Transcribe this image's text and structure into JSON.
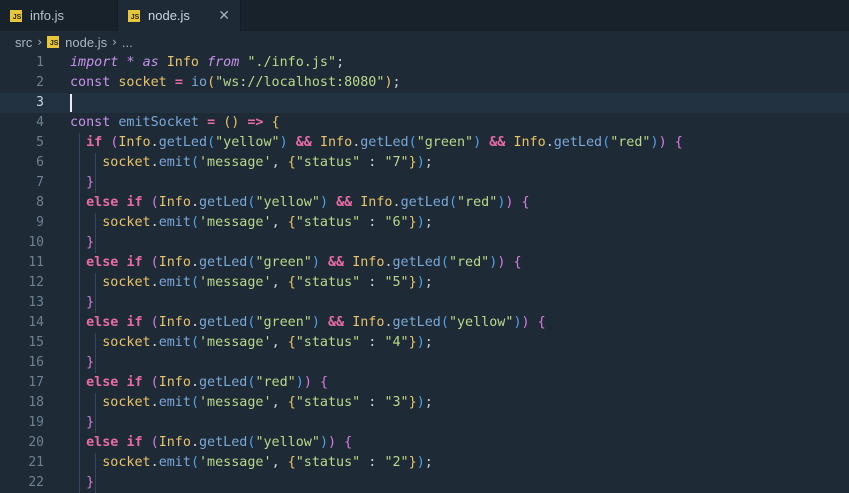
{
  "tabs": [
    {
      "badge": "JS",
      "label": "info.js",
      "active": false
    },
    {
      "badge": "JS",
      "label": "node.js",
      "active": true,
      "close": "✕"
    }
  ],
  "breadcrumb": {
    "folder": "src",
    "sep": "›",
    "badge": "JS",
    "file": "node.js",
    "more": "..."
  },
  "editor": {
    "current_line": 3,
    "lines": [
      {
        "n": "1",
        "tokens": [
          [
            "kw-italic",
            "import"
          ],
          [
            "punc",
            " "
          ],
          [
            "kw-italic",
            "*"
          ],
          [
            "punc",
            " "
          ],
          [
            "kw-italic",
            "as"
          ],
          [
            "punc",
            " "
          ],
          [
            "cls",
            "Info"
          ],
          [
            "punc",
            " "
          ],
          [
            "kw-italic",
            "from"
          ],
          [
            "punc",
            " "
          ],
          [
            "str",
            "\"./info.js\""
          ],
          [
            "punc",
            ";"
          ]
        ]
      },
      {
        "n": "2",
        "tokens": [
          [
            "kw",
            "const"
          ],
          [
            "punc",
            " "
          ],
          [
            "cls",
            "socket"
          ],
          [
            "punc",
            " "
          ],
          [
            "op",
            "="
          ],
          [
            "punc",
            " "
          ],
          [
            "fn",
            "io"
          ],
          [
            "p1",
            "("
          ],
          [
            "str",
            "\"ws://localhost:8080\""
          ],
          [
            "p1",
            ")"
          ],
          [
            "punc",
            ";"
          ]
        ]
      },
      {
        "n": "3",
        "tokens": []
      },
      {
        "n": "4",
        "tokens": [
          [
            "kw",
            "const"
          ],
          [
            "punc",
            " "
          ],
          [
            "fn",
            "emitSocket"
          ],
          [
            "punc",
            " "
          ],
          [
            "op",
            "="
          ],
          [
            "punc",
            " "
          ],
          [
            "p1",
            "()"
          ],
          [
            "punc",
            " "
          ],
          [
            "op",
            "=>"
          ],
          [
            "punc",
            " "
          ],
          [
            "p1",
            "{"
          ]
        ]
      },
      {
        "n": "5",
        "tokens": [
          [
            "punc",
            "  "
          ],
          [
            "kw-bold",
            "if"
          ],
          [
            "punc",
            " "
          ],
          [
            "p2",
            "("
          ],
          [
            "cls",
            "Info"
          ],
          [
            "punc",
            "."
          ],
          [
            "fn",
            "getLed"
          ],
          [
            "p3",
            "("
          ],
          [
            "str",
            "\"yellow\""
          ],
          [
            "p3",
            ")"
          ],
          [
            "punc",
            " "
          ],
          [
            "op",
            "&&"
          ],
          [
            "punc",
            " "
          ],
          [
            "cls",
            "Info"
          ],
          [
            "punc",
            "."
          ],
          [
            "fn",
            "getLed"
          ],
          [
            "p3",
            "("
          ],
          [
            "str",
            "\"green\""
          ],
          [
            "p3",
            ")"
          ],
          [
            "punc",
            " "
          ],
          [
            "op",
            "&&"
          ],
          [
            "punc",
            " "
          ],
          [
            "cls",
            "Info"
          ],
          [
            "punc",
            "."
          ],
          [
            "fn",
            "getLed"
          ],
          [
            "p3",
            "("
          ],
          [
            "str",
            "\"red\""
          ],
          [
            "p3",
            ")"
          ],
          [
            "p2",
            ")"
          ],
          [
            "punc",
            " "
          ],
          [
            "p2",
            "{"
          ]
        ]
      },
      {
        "n": "6",
        "tokens": [
          [
            "punc",
            "    "
          ],
          [
            "cls",
            "socket"
          ],
          [
            "punc",
            "."
          ],
          [
            "fn",
            "emit"
          ],
          [
            "p3",
            "("
          ],
          [
            "str",
            "'message'"
          ],
          [
            "punc",
            ", "
          ],
          [
            "p1",
            "{"
          ],
          [
            "str",
            "\"status\""
          ],
          [
            "punc",
            " : "
          ],
          [
            "str",
            "\"7\""
          ],
          [
            "p1",
            "}"
          ],
          [
            "p3",
            ")"
          ],
          [
            "punc",
            ";"
          ]
        ]
      },
      {
        "n": "7",
        "tokens": [
          [
            "punc",
            "  "
          ],
          [
            "p2",
            "}"
          ]
        ]
      },
      {
        "n": "8",
        "tokens": [
          [
            "punc",
            "  "
          ],
          [
            "kw-bold",
            "else"
          ],
          [
            "punc",
            " "
          ],
          [
            "kw-bold",
            "if"
          ],
          [
            "punc",
            " "
          ],
          [
            "p2",
            "("
          ],
          [
            "cls",
            "Info"
          ],
          [
            "punc",
            "."
          ],
          [
            "fn",
            "getLed"
          ],
          [
            "p3",
            "("
          ],
          [
            "str",
            "\"yellow\""
          ],
          [
            "p3",
            ")"
          ],
          [
            "punc",
            " "
          ],
          [
            "op",
            "&&"
          ],
          [
            "punc",
            " "
          ],
          [
            "cls",
            "Info"
          ],
          [
            "punc",
            "."
          ],
          [
            "fn",
            "getLed"
          ],
          [
            "p3",
            "("
          ],
          [
            "str",
            "\"red\""
          ],
          [
            "p3",
            ")"
          ],
          [
            "p2",
            ")"
          ],
          [
            "punc",
            " "
          ],
          [
            "p2",
            "{"
          ]
        ]
      },
      {
        "n": "9",
        "tokens": [
          [
            "punc",
            "    "
          ],
          [
            "cls",
            "socket"
          ],
          [
            "punc",
            "."
          ],
          [
            "fn",
            "emit"
          ],
          [
            "p3",
            "("
          ],
          [
            "str",
            "'message'"
          ],
          [
            "punc",
            ", "
          ],
          [
            "p1",
            "{"
          ],
          [
            "str",
            "\"status\""
          ],
          [
            "punc",
            " : "
          ],
          [
            "str",
            "\"6\""
          ],
          [
            "p1",
            "}"
          ],
          [
            "p3",
            ")"
          ],
          [
            "punc",
            ";"
          ]
        ]
      },
      {
        "n": "10",
        "tokens": [
          [
            "punc",
            "  "
          ],
          [
            "p2",
            "}"
          ]
        ]
      },
      {
        "n": "11",
        "tokens": [
          [
            "punc",
            "  "
          ],
          [
            "kw-bold",
            "else"
          ],
          [
            "punc",
            " "
          ],
          [
            "kw-bold",
            "if"
          ],
          [
            "punc",
            " "
          ],
          [
            "p2",
            "("
          ],
          [
            "cls",
            "Info"
          ],
          [
            "punc",
            "."
          ],
          [
            "fn",
            "getLed"
          ],
          [
            "p3",
            "("
          ],
          [
            "str",
            "\"green\""
          ],
          [
            "p3",
            ")"
          ],
          [
            "punc",
            " "
          ],
          [
            "op",
            "&&"
          ],
          [
            "punc",
            " "
          ],
          [
            "cls",
            "Info"
          ],
          [
            "punc",
            "."
          ],
          [
            "fn",
            "getLed"
          ],
          [
            "p3",
            "("
          ],
          [
            "str",
            "\"red\""
          ],
          [
            "p3",
            ")"
          ],
          [
            "p2",
            ")"
          ],
          [
            "punc",
            " "
          ],
          [
            "p2",
            "{"
          ]
        ]
      },
      {
        "n": "12",
        "tokens": [
          [
            "punc",
            "    "
          ],
          [
            "cls",
            "socket"
          ],
          [
            "punc",
            "."
          ],
          [
            "fn",
            "emit"
          ],
          [
            "p3",
            "("
          ],
          [
            "str",
            "'message'"
          ],
          [
            "punc",
            ", "
          ],
          [
            "p1",
            "{"
          ],
          [
            "str",
            "\"status\""
          ],
          [
            "punc",
            " : "
          ],
          [
            "str",
            "\"5\""
          ],
          [
            "p1",
            "}"
          ],
          [
            "p3",
            ")"
          ],
          [
            "punc",
            ";"
          ]
        ]
      },
      {
        "n": "13",
        "tokens": [
          [
            "punc",
            "  "
          ],
          [
            "p2",
            "}"
          ]
        ]
      },
      {
        "n": "14",
        "tokens": [
          [
            "punc",
            "  "
          ],
          [
            "kw-bold",
            "else"
          ],
          [
            "punc",
            " "
          ],
          [
            "kw-bold",
            "if"
          ],
          [
            "punc",
            " "
          ],
          [
            "p2",
            "("
          ],
          [
            "cls",
            "Info"
          ],
          [
            "punc",
            "."
          ],
          [
            "fn",
            "getLed"
          ],
          [
            "p3",
            "("
          ],
          [
            "str",
            "\"green\""
          ],
          [
            "p3",
            ")"
          ],
          [
            "punc",
            " "
          ],
          [
            "op",
            "&&"
          ],
          [
            "punc",
            " "
          ],
          [
            "cls",
            "Info"
          ],
          [
            "punc",
            "."
          ],
          [
            "fn",
            "getLed"
          ],
          [
            "p3",
            "("
          ],
          [
            "str",
            "\"yellow\""
          ],
          [
            "p3",
            ")"
          ],
          [
            "p2",
            ")"
          ],
          [
            "punc",
            " "
          ],
          [
            "p2",
            "{"
          ]
        ]
      },
      {
        "n": "15",
        "tokens": [
          [
            "punc",
            "    "
          ],
          [
            "cls",
            "socket"
          ],
          [
            "punc",
            "."
          ],
          [
            "fn",
            "emit"
          ],
          [
            "p3",
            "("
          ],
          [
            "str",
            "'message'"
          ],
          [
            "punc",
            ", "
          ],
          [
            "p1",
            "{"
          ],
          [
            "str",
            "\"status\""
          ],
          [
            "punc",
            " : "
          ],
          [
            "str",
            "\"4\""
          ],
          [
            "p1",
            "}"
          ],
          [
            "p3",
            ")"
          ],
          [
            "punc",
            ";"
          ]
        ]
      },
      {
        "n": "16",
        "tokens": [
          [
            "punc",
            "  "
          ],
          [
            "p2",
            "}"
          ]
        ]
      },
      {
        "n": "17",
        "tokens": [
          [
            "punc",
            "  "
          ],
          [
            "kw-bold",
            "else"
          ],
          [
            "punc",
            " "
          ],
          [
            "kw-bold",
            "if"
          ],
          [
            "punc",
            " "
          ],
          [
            "p2",
            "("
          ],
          [
            "cls",
            "Info"
          ],
          [
            "punc",
            "."
          ],
          [
            "fn",
            "getLed"
          ],
          [
            "p3",
            "("
          ],
          [
            "str",
            "\"red\""
          ],
          [
            "p3",
            ")"
          ],
          [
            "p2",
            ")"
          ],
          [
            "punc",
            " "
          ],
          [
            "p2",
            "{"
          ]
        ]
      },
      {
        "n": "18",
        "tokens": [
          [
            "punc",
            "    "
          ],
          [
            "cls",
            "socket"
          ],
          [
            "punc",
            "."
          ],
          [
            "fn",
            "emit"
          ],
          [
            "p3",
            "("
          ],
          [
            "str",
            "'message'"
          ],
          [
            "punc",
            ", "
          ],
          [
            "p1",
            "{"
          ],
          [
            "str",
            "\"status\""
          ],
          [
            "punc",
            " : "
          ],
          [
            "str",
            "\"3\""
          ],
          [
            "p1",
            "}"
          ],
          [
            "p3",
            ")"
          ],
          [
            "punc",
            ";"
          ]
        ]
      },
      {
        "n": "19",
        "tokens": [
          [
            "punc",
            "  "
          ],
          [
            "p2",
            "}"
          ]
        ]
      },
      {
        "n": "20",
        "tokens": [
          [
            "punc",
            "  "
          ],
          [
            "kw-bold",
            "else"
          ],
          [
            "punc",
            " "
          ],
          [
            "kw-bold",
            "if"
          ],
          [
            "punc",
            " "
          ],
          [
            "p2",
            "("
          ],
          [
            "cls",
            "Info"
          ],
          [
            "punc",
            "."
          ],
          [
            "fn",
            "getLed"
          ],
          [
            "p3",
            "("
          ],
          [
            "str",
            "\"yellow\""
          ],
          [
            "p3",
            ")"
          ],
          [
            "p2",
            ")"
          ],
          [
            "punc",
            " "
          ],
          [
            "p2",
            "{"
          ]
        ]
      },
      {
        "n": "21",
        "tokens": [
          [
            "punc",
            "    "
          ],
          [
            "cls",
            "socket"
          ],
          [
            "punc",
            "."
          ],
          [
            "fn",
            "emit"
          ],
          [
            "p3",
            "("
          ],
          [
            "str",
            "'message'"
          ],
          [
            "punc",
            ", "
          ],
          [
            "p1",
            "{"
          ],
          [
            "str",
            "\"status\""
          ],
          [
            "punc",
            " : "
          ],
          [
            "str",
            "\"2\""
          ],
          [
            "p1",
            "}"
          ],
          [
            "p3",
            ")"
          ],
          [
            "punc",
            ";"
          ]
        ]
      },
      {
        "n": "22",
        "tokens": [
          [
            "punc",
            "  "
          ],
          [
            "p2",
            "}"
          ]
        ]
      }
    ]
  }
}
